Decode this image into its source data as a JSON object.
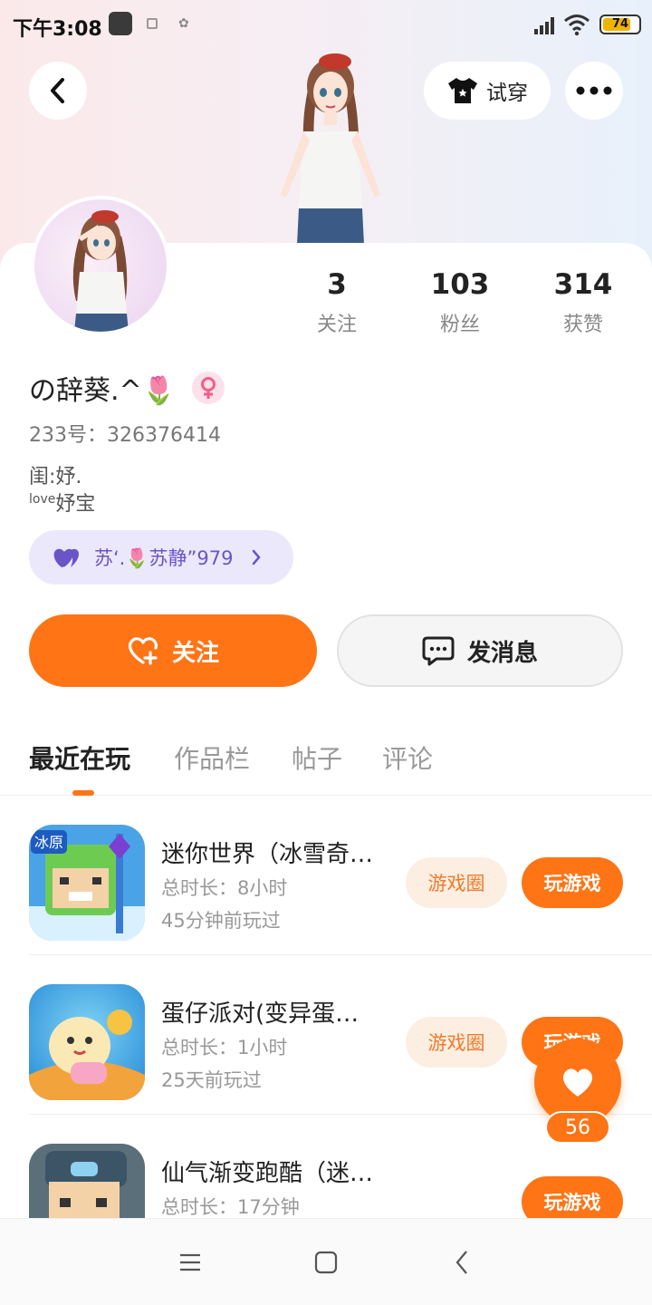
{
  "status_bar": {
    "time": "下午3:08",
    "battery": "74"
  },
  "header": {
    "try_on_label": "试穿",
    "icons": [
      "back-arrow-icon",
      "tshirt-icon",
      "more-dots-icon"
    ]
  },
  "profile": {
    "stats": [
      {
        "value": "3",
        "label": "关注"
      },
      {
        "value": "103",
        "label": "粉丝"
      },
      {
        "value": "314",
        "label": "获赞"
      }
    ],
    "username": "の辞葵.^🌷",
    "uid": "233号：326376414",
    "bio_line1": "闺:妤.",
    "bio_line2_sup": "love",
    "bio_line2": "妤宝",
    "cp_tag": "苏‘.🌷苏静”979",
    "accent_color": "#ff7415",
    "cp_color": "#6a55c8"
  },
  "actions": {
    "follow_label": "关注",
    "message_label": "发消息"
  },
  "tabs": [
    {
      "label": "最近在玩",
      "active": true
    },
    {
      "label": "作品栏",
      "active": false
    },
    {
      "label": "帖子",
      "active": false
    },
    {
      "label": "评论",
      "active": false
    }
  ],
  "games": [
    {
      "title": "迷你世界（冰雪奇…",
      "duration": "总时长：8小时",
      "last_played": "45分钟前玩过",
      "circle_label": "游戏圈",
      "play_label": "玩游戏",
      "icon_badge": "冰原"
    },
    {
      "title": "蛋仔派对(变异蛋…",
      "duration": "总时长：1小时",
      "last_played": "25天前玩过",
      "circle_label": "游戏圈",
      "play_label": "玩游戏"
    },
    {
      "title": "仙气渐变跑酷（迷你世界）",
      "duration": "总时长：17分钟",
      "play_label": "玩游戏"
    }
  ],
  "like_fab": {
    "count": "56"
  }
}
